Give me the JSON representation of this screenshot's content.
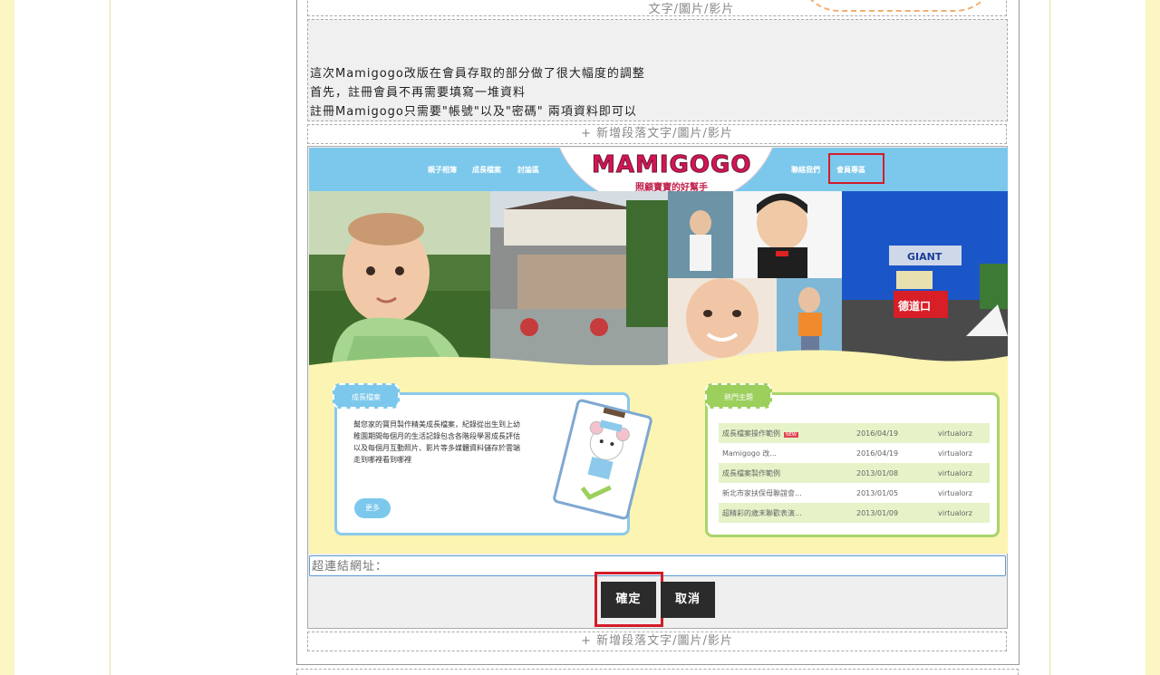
{
  "editor": {
    "top_add_label": "文字/圖片/影片",
    "text_block_lines": [
      "這次Mamigogo改版在會員存取的部分做了很大幅度的調整",
      "首先，註冊會員不再需要填寫一堆資料",
      "註冊Mamigogo只需要\"帳號\"以及\"密碼\" 兩項資料即可以"
    ],
    "add_paragraph_label": "+ 新增段落文字/圖片/影片",
    "link_placeholder": "超連結網址：",
    "confirm_label": "確定",
    "cancel_label": "取消"
  },
  "site_image": {
    "nav_left": [
      "親子相簿",
      "成長檔案",
      "討論區"
    ],
    "nav_right": [
      "聯絡我們",
      "會員專區"
    ],
    "logo_text": "MAMIGOGO",
    "logo_subtitle": "照顧寶寶的好幫手",
    "growth_card": {
      "tag": "成長檔案",
      "description": "幫您家的寶貝製作精美成長檔案，紀錄從出生到上幼稚園期間每個月的生活記錄包含各階段學習成長評估以及每個月互動照片、影片等多媒體資料儲存於雲端走到哪裡看到哪裡",
      "more_label": "更多"
    },
    "hot_card": {
      "tag": "熱門主題",
      "rows": [
        {
          "title": "成長檔案操作範例",
          "badge": "NEW",
          "date": "2016/04/19",
          "author": "virtualorz"
        },
        {
          "title": "Mamigogo 改...",
          "badge": "",
          "date": "2016/04/19",
          "author": "virtualorz"
        },
        {
          "title": "成長檔案製作範例",
          "badge": "",
          "date": "2013/01/08",
          "author": "virtualorz"
        },
        {
          "title": "新北市家扶保母聯誼會...",
          "badge": "",
          "date": "2013/01/05",
          "author": "virtualorz"
        },
        {
          "title": "超精彩的歲末聯歡表演...",
          "badge": "",
          "date": "2013/01/09",
          "author": "virtualorz"
        }
      ]
    },
    "sign_texts": [
      "GIANT",
      "德道口"
    ]
  },
  "colors": {
    "page_bg": "#fbf6c4",
    "nav_blue": "#7cc8ec",
    "highlight_red": "#d31c28",
    "green": "#9ccf5c",
    "button_dark": "#2b2b2b"
  }
}
